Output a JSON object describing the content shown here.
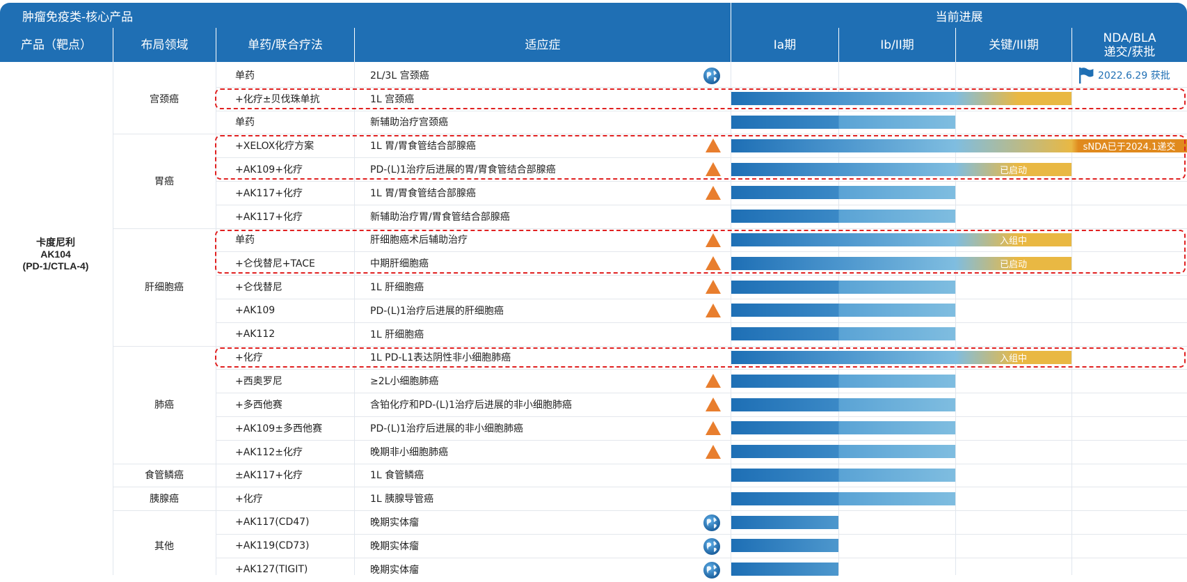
{
  "header": {
    "section_title": "肿瘤免疫类-核心产品",
    "progress_title": "当前进展",
    "columns": {
      "product": "产品（靶点）",
      "field": "布局领域",
      "therapy": "单药/联合疗法",
      "indication": "适应症",
      "phase1a": "Ia期",
      "phase1b2": "Ib/II期",
      "phase3": "关键/III期",
      "nda_line1": "NDA/BLA",
      "nda_line2": "递交/获批"
    }
  },
  "product": {
    "name": "卡度尼利",
    "code": "AK104",
    "target": "(PD-1/CTLA-4)"
  },
  "colors": {
    "header_blue": "#1f6fb4",
    "bar_blue_dark": "#1e6fb5",
    "bar_blue_light": "#7fbde0",
    "bar_gold": "#e9b843",
    "bar_orange": "#e08a1e",
    "triangle": "#e87e2e",
    "highlight": "#e02020"
  },
  "groups": [
    {
      "label": "宫颈癌",
      "rows": 3
    },
    {
      "label": "胃癌",
      "rows": 4
    },
    {
      "label": "肝细胞癌",
      "rows": 5
    },
    {
      "label": "肺癌",
      "rows": 5
    },
    {
      "label": "食管鳞癌",
      "rows": 1
    },
    {
      "label": "胰腺癌",
      "rows": 1
    },
    {
      "label": "其他",
      "rows": 3
    }
  ],
  "rows": [
    {
      "therapy": "单药",
      "indication": "2L/3L 宫颈癌",
      "marker": "globe",
      "stage": 0,
      "approved_text": "2022.6.29 获批"
    },
    {
      "therapy": "+化疗±贝伐珠单抗",
      "indication": "1L 宫颈癌",
      "marker": "",
      "stage": 3,
      "bar_text": ""
    },
    {
      "therapy": "单药",
      "indication": "新辅助治疗宫颈癌",
      "marker": "",
      "stage": 2,
      "bar_text": ""
    },
    {
      "therapy": "+XELOX化疗方案",
      "indication": "1L 胃/胃食管结合部腺癌",
      "marker": "triangle",
      "stage": 4,
      "bar_text": "sNDA已于2024.1递交"
    },
    {
      "therapy": "+AK109+化疗",
      "indication": "PD-(L)1治疗后进展的胃/胃食管结合部腺癌",
      "marker": "triangle",
      "stage": 3,
      "bar_text": "已启动"
    },
    {
      "therapy": "+AK117+化疗",
      "indication": "1L 胃/胃食管结合部腺癌",
      "marker": "triangle",
      "stage": 2,
      "bar_text": ""
    },
    {
      "therapy": "+AK117+化疗",
      "indication": "新辅助治疗胃/胃食管结合部腺癌",
      "marker": "",
      "stage": 2,
      "bar_text": ""
    },
    {
      "therapy": "单药",
      "indication": "肝细胞癌术后辅助治疗",
      "marker": "triangle",
      "stage": 3,
      "bar_text": "入组中"
    },
    {
      "therapy": "+仑伐替尼+TACE",
      "indication": "中期肝细胞癌",
      "marker": "triangle",
      "stage": 3,
      "bar_text": "已启动"
    },
    {
      "therapy": "+仑伐替尼",
      "indication": "1L 肝细胞癌",
      "marker": "triangle",
      "stage": 2,
      "bar_text": ""
    },
    {
      "therapy": "+AK109",
      "indication": "PD-(L)1治疗后进展的肝细胞癌",
      "marker": "triangle",
      "stage": 2,
      "bar_text": ""
    },
    {
      "therapy": "+AK112",
      "indication": "1L 肝细胞癌",
      "marker": "",
      "stage": 2,
      "bar_text": ""
    },
    {
      "therapy": "+化疗",
      "indication": "1L PD-L1表达阴性非小细胞肺癌",
      "marker": "",
      "stage": 3,
      "bar_text": "入组中"
    },
    {
      "therapy": "+西奥罗尼",
      "indication": "≥2L小细胞肺癌",
      "marker": "triangle",
      "stage": 2,
      "bar_text": ""
    },
    {
      "therapy": "+多西他赛",
      "indication": "含铂化疗和PD-(L)1治疗后进展的非小细胞肺癌",
      "marker": "triangle",
      "stage": 2,
      "bar_text": ""
    },
    {
      "therapy": "+AK109±多西他赛",
      "indication": "PD-(L)1治疗后进展的非小细胞肺癌",
      "marker": "triangle",
      "stage": 2,
      "bar_text": ""
    },
    {
      "therapy": "+AK112±化疗",
      "indication": "晚期非小细胞肺癌",
      "marker": "triangle",
      "stage": 2,
      "bar_text": ""
    },
    {
      "therapy": "±AK117+化疗",
      "indication": "1L 食管鳞癌",
      "marker": "",
      "stage": 2,
      "bar_text": ""
    },
    {
      "therapy": "+化疗",
      "indication": "1L 胰腺导管癌",
      "marker": "",
      "stage": 2,
      "bar_text": ""
    },
    {
      "therapy": "+AK117(CD47)",
      "indication": "晚期实体瘤",
      "marker": "globe",
      "stage": 1,
      "bar_text": ""
    },
    {
      "therapy": "+AK119(CD73)",
      "indication": "晚期实体瘤",
      "marker": "globe",
      "stage": 1,
      "bar_text": ""
    },
    {
      "therapy": "+AK127(TIGIT)",
      "indication": "晚期实体瘤",
      "marker": "globe",
      "stage": 1,
      "bar_text": ""
    }
  ],
  "highlights": [
    [
      1,
      1
    ],
    [
      3,
      4
    ],
    [
      7,
      8
    ],
    [
      12,
      12
    ]
  ]
}
